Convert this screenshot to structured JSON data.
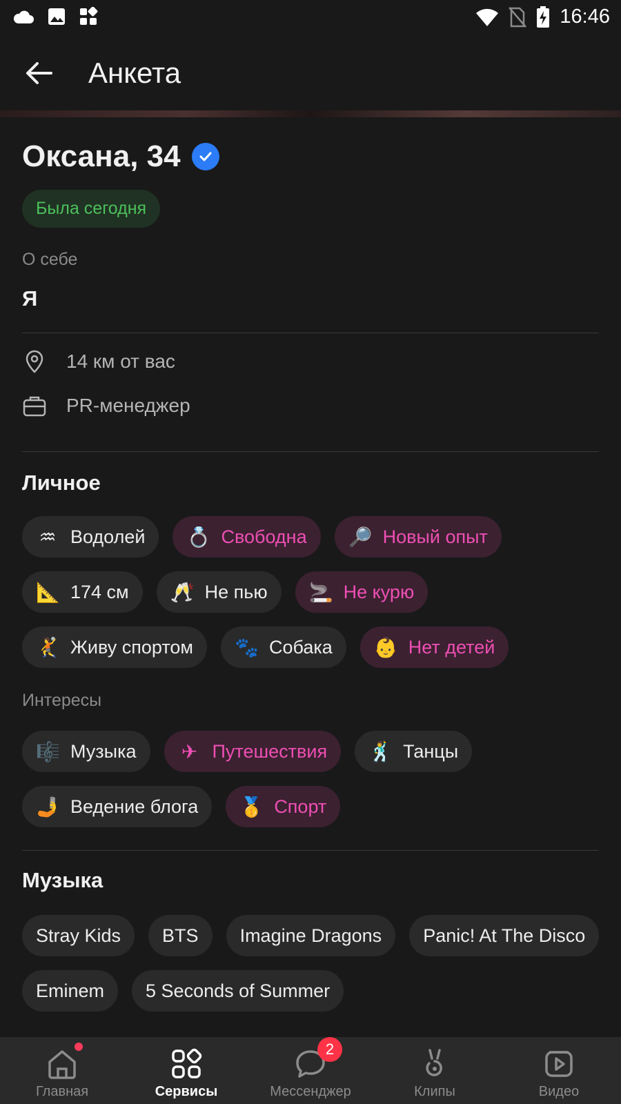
{
  "status_bar": {
    "time": "16:46"
  },
  "app_bar": {
    "title": "Анкета"
  },
  "profile": {
    "name_age": "Оксана, 34",
    "status": "Была сегодня",
    "about_label": "О себе",
    "about_text": "Я",
    "distance": "14 км от вас",
    "job": "PR-менеджер"
  },
  "personal": {
    "title": "Личное",
    "chips": [
      {
        "emoji": "♒",
        "label": "Водолей",
        "highlighted": false
      },
      {
        "emoji": "💍",
        "label": "Свободна",
        "highlighted": true
      },
      {
        "emoji": "🔎",
        "label": "Новый опыт",
        "highlighted": true
      },
      {
        "emoji": "📐",
        "label": "174 см",
        "highlighted": false
      },
      {
        "emoji": "🥂",
        "label": "Не пью",
        "highlighted": false
      },
      {
        "emoji": "🚬",
        "label": "Не курю",
        "highlighted": true
      },
      {
        "emoji": "🤾",
        "label": "Живу спортом",
        "highlighted": false
      },
      {
        "emoji": "🐾",
        "label": "Собака",
        "highlighted": false
      },
      {
        "emoji": "👶",
        "label": "Нет детей",
        "highlighted": true
      }
    ]
  },
  "interests": {
    "title": "Интересы",
    "chips": [
      {
        "emoji": "🎼",
        "label": "Музыка",
        "highlighted": false
      },
      {
        "emoji": "✈",
        "label": "Путешествия",
        "highlighted": true
      },
      {
        "emoji": "🕺",
        "label": "Танцы",
        "highlighted": false
      },
      {
        "emoji": "🤳",
        "label": "Ведение блога",
        "highlighted": false
      },
      {
        "emoji": "🥇",
        "label": "Спорт",
        "highlighted": true
      }
    ]
  },
  "music": {
    "title": "Музыка",
    "chips": [
      "Stray Kids",
      "BTS",
      "Imagine Dragons",
      "Panic! At The Disco",
      "Eminem",
      "5 Seconds of Summer"
    ]
  },
  "tab_bar": {
    "items": [
      {
        "label": "Главная",
        "icon": "home-icon",
        "active": false,
        "dot": true
      },
      {
        "label": "Сервисы",
        "icon": "services-icon",
        "active": true
      },
      {
        "label": "Мессенджер",
        "icon": "messenger-icon",
        "active": false,
        "badge": "2"
      },
      {
        "label": "Клипы",
        "icon": "clips-icon",
        "active": false
      },
      {
        "label": "Видео",
        "icon": "video-icon",
        "active": false
      }
    ]
  },
  "colors": {
    "accent_pink": "#ee4fb3",
    "online_green": "#4cc05c",
    "verified_blue": "#2b7cf6",
    "badge_red": "#ff3347"
  }
}
